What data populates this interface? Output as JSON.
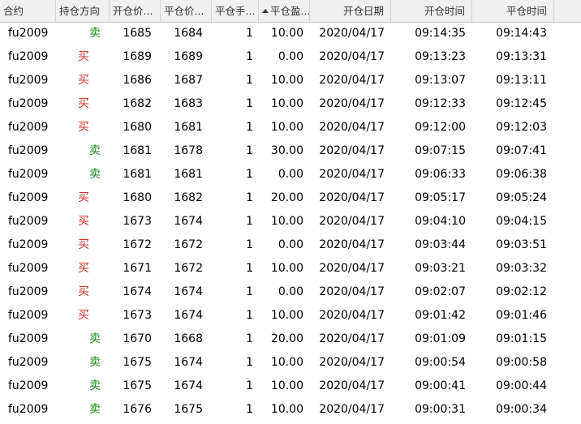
{
  "headers": [
    "合约",
    "持仓方向",
    "开仓价...",
    "平仓价...",
    "平仓手...",
    "平仓盈...",
    "开仓日期",
    "开仓时间",
    "平仓时间"
  ],
  "colors": {
    "buy": "#d8322e",
    "sell": "#1f8a1f",
    "header_bg": "#f0f0f0"
  },
  "rows": [
    {
      "c": "fu2009",
      "d": "卖",
      "op": "1685",
      "cp": "1684",
      "q": "1",
      "pl": "10.00",
      "date": "2020/04/17",
      "ot": "09:14:35",
      "ct": "09:14:43"
    },
    {
      "c": "fu2009",
      "d": "买",
      "op": "1689",
      "cp": "1689",
      "q": "1",
      "pl": "0.00",
      "date": "2020/04/17",
      "ot": "09:13:23",
      "ct": "09:13:31"
    },
    {
      "c": "fu2009",
      "d": "买",
      "op": "1686",
      "cp": "1687",
      "q": "1",
      "pl": "10.00",
      "date": "2020/04/17",
      "ot": "09:13:07",
      "ct": "09:13:11"
    },
    {
      "c": "fu2009",
      "d": "买",
      "op": "1682",
      "cp": "1683",
      "q": "1",
      "pl": "10.00",
      "date": "2020/04/17",
      "ot": "09:12:33",
      "ct": "09:12:45"
    },
    {
      "c": "fu2009",
      "d": "买",
      "op": "1680",
      "cp": "1681",
      "q": "1",
      "pl": "10.00",
      "date": "2020/04/17",
      "ot": "09:12:00",
      "ct": "09:12:03"
    },
    {
      "c": "fu2009",
      "d": "卖",
      "op": "1681",
      "cp": "1678",
      "q": "1",
      "pl": "30.00",
      "date": "2020/04/17",
      "ot": "09:07:15",
      "ct": "09:07:41"
    },
    {
      "c": "fu2009",
      "d": "卖",
      "op": "1681",
      "cp": "1681",
      "q": "1",
      "pl": "0.00",
      "date": "2020/04/17",
      "ot": "09:06:33",
      "ct": "09:06:38"
    },
    {
      "c": "fu2009",
      "d": "买",
      "op": "1680",
      "cp": "1682",
      "q": "1",
      "pl": "20.00",
      "date": "2020/04/17",
      "ot": "09:05:17",
      "ct": "09:05:24"
    },
    {
      "c": "fu2009",
      "d": "买",
      "op": "1673",
      "cp": "1674",
      "q": "1",
      "pl": "10.00",
      "date": "2020/04/17",
      "ot": "09:04:10",
      "ct": "09:04:15"
    },
    {
      "c": "fu2009",
      "d": "买",
      "op": "1672",
      "cp": "1672",
      "q": "1",
      "pl": "0.00",
      "date": "2020/04/17",
      "ot": "09:03:44",
      "ct": "09:03:51"
    },
    {
      "c": "fu2009",
      "d": "买",
      "op": "1671",
      "cp": "1672",
      "q": "1",
      "pl": "10.00",
      "date": "2020/04/17",
      "ot": "09:03:21",
      "ct": "09:03:32"
    },
    {
      "c": "fu2009",
      "d": "买",
      "op": "1674",
      "cp": "1674",
      "q": "1",
      "pl": "0.00",
      "date": "2020/04/17",
      "ot": "09:02:07",
      "ct": "09:02:12"
    },
    {
      "c": "fu2009",
      "d": "买",
      "op": "1673",
      "cp": "1674",
      "q": "1",
      "pl": "10.00",
      "date": "2020/04/17",
      "ot": "09:01:42",
      "ct": "09:01:46"
    },
    {
      "c": "fu2009",
      "d": "卖",
      "op": "1670",
      "cp": "1668",
      "q": "1",
      "pl": "20.00",
      "date": "2020/04/17",
      "ot": "09:01:09",
      "ct": "09:01:15"
    },
    {
      "c": "fu2009",
      "d": "卖",
      "op": "1675",
      "cp": "1674",
      "q": "1",
      "pl": "10.00",
      "date": "2020/04/17",
      "ot": "09:00:54",
      "ct": "09:00:58"
    },
    {
      "c": "fu2009",
      "d": "卖",
      "op": "1675",
      "cp": "1674",
      "q": "1",
      "pl": "10.00",
      "date": "2020/04/17",
      "ot": "09:00:41",
      "ct": "09:00:44"
    },
    {
      "c": "fu2009",
      "d": "卖",
      "op": "1676",
      "cp": "1675",
      "q": "1",
      "pl": "10.00",
      "date": "2020/04/17",
      "ot": "09:00:31",
      "ct": "09:00:34"
    }
  ]
}
